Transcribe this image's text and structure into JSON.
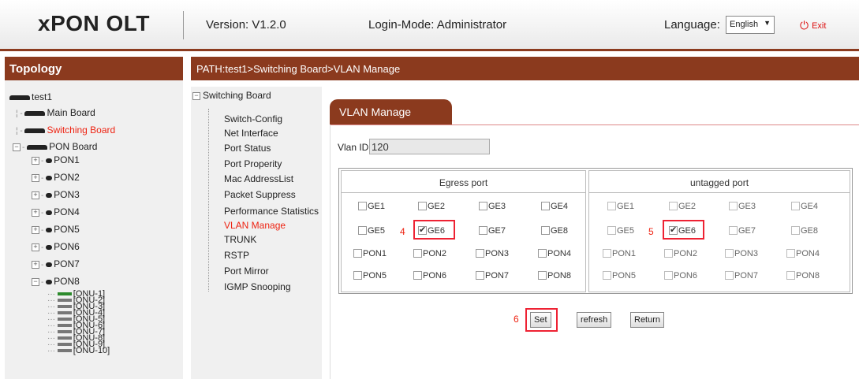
{
  "header": {
    "logo": "xPON OLT",
    "version": "Version: V1.2.0",
    "login_mode": "Login-Mode: Administrator",
    "language_label": "Language:",
    "language_value": "English",
    "exit_label": "Exit"
  },
  "topology": {
    "title": "Topology",
    "root": "test1",
    "main_board": "Main Board",
    "switching_board": "Switching Board",
    "pon_board": "PON Board",
    "pons": [
      "PON1",
      "PON2",
      "PON3",
      "PON4",
      "PON5",
      "PON6",
      "PON7",
      "PON8"
    ],
    "onus": [
      "[ONU-1]",
      "[ONU-2]",
      "[ONU-3]",
      "[ONU-4]",
      "[ONU-5]",
      "[ONU-6]",
      "[ONU-7]",
      "[ONU-8]",
      "[ONU-9]",
      "[ONU-10]"
    ]
  },
  "path": "PATH:test1>Switching Board>VLAN Manage",
  "menu": {
    "root": "Switching Board",
    "items": [
      "Switch-Config",
      "Net Interface",
      "Port Status",
      "Port Properity",
      "Mac AddressList",
      "Packet Suppress",
      "Performance Statistics",
      "VLAN Manage",
      "TRUNK",
      "RSTP",
      "Port Mirror",
      "IGMP Snooping"
    ],
    "active": "VLAN Manage"
  },
  "tab": "VLAN Manage",
  "vlan": {
    "label": "Vlan ID",
    "value": "120"
  },
  "egress": {
    "title": "Egress port",
    "ports": [
      "GE1",
      "GE2",
      "GE3",
      "GE4",
      "GE5",
      "GE6",
      "GE7",
      "GE8",
      "PON1",
      "PON2",
      "PON3",
      "PON4",
      "PON5",
      "PON6",
      "PON7",
      "PON8"
    ],
    "checked": [
      "GE6"
    ]
  },
  "untagged": {
    "title": "untagged port",
    "ports": [
      "GE1",
      "GE2",
      "GE3",
      "GE4",
      "GE5",
      "GE6",
      "GE7",
      "GE8",
      "PON1",
      "PON2",
      "PON3",
      "PON4",
      "PON5",
      "PON6",
      "PON7",
      "PON8"
    ],
    "checked": [
      "GE6"
    ]
  },
  "steps": {
    "egress": "4",
    "untagged": "5",
    "set": "6"
  },
  "buttons": {
    "set": "Set",
    "refresh": "refresh",
    "return": "Return"
  },
  "colors": {
    "accent": "#8b3a1e",
    "highlight": "#e22233"
  }
}
